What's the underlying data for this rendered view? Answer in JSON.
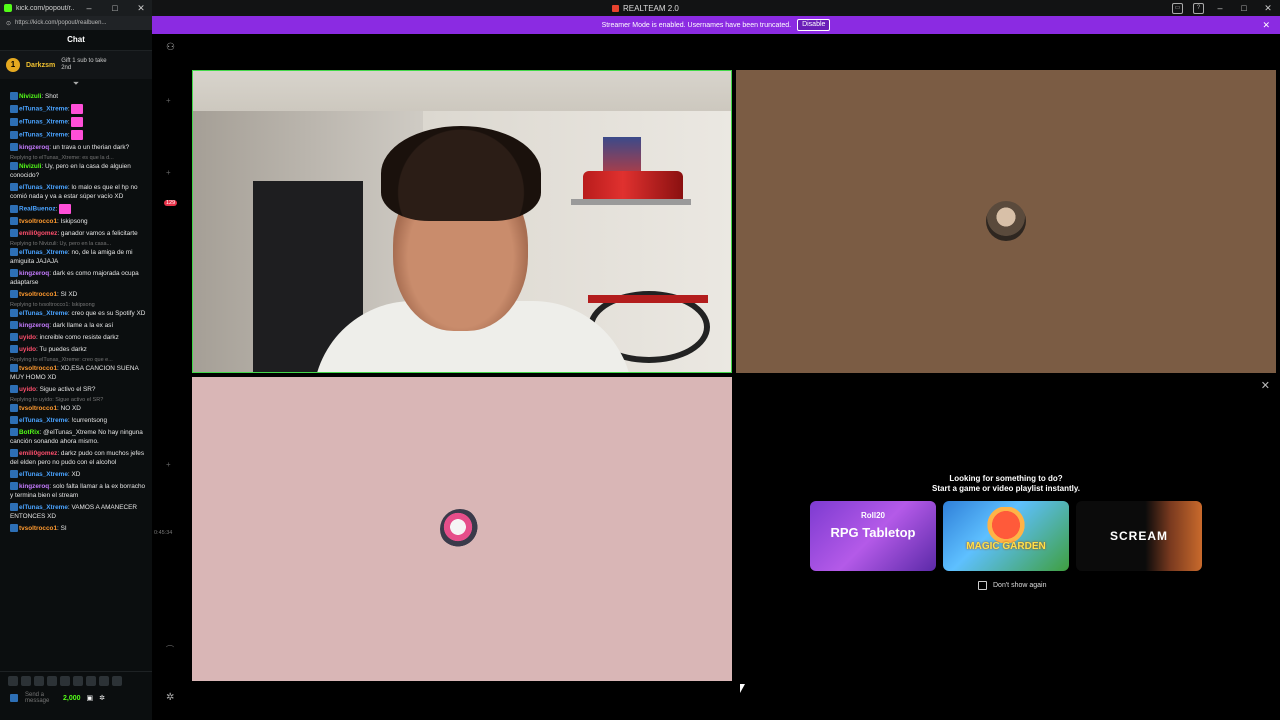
{
  "popout": {
    "title": "kick.com/popout/r...",
    "url": "https://kick.com/popout/realbuen...",
    "controls": [
      "–",
      "□",
      "✕"
    ]
  },
  "chat": {
    "header": "Chat",
    "pinned": {
      "rank": "1",
      "name": "Darkzsm",
      "info": "Gift 1 sub to take 2nd"
    },
    "messages": [
      {
        "user": "Nivizuli",
        "color": "#53fc18",
        "text": "Shot",
        "reply": ""
      },
      {
        "user": "elTunas_Xtreme",
        "color": "#4aa3ff",
        "text": "",
        "reply": ""
      },
      {
        "user": "elTunas_Xtreme",
        "color": "#4aa3ff",
        "text": "",
        "reply": ""
      },
      {
        "user": "elTunas_Xtreme",
        "color": "#4aa3ff",
        "text": "",
        "reply": ""
      },
      {
        "user": "kingzeroq",
        "color": "#c57bff",
        "text": "un trava o un therian dark?",
        "reply": ""
      },
      {
        "user": "Nivizuli",
        "color": "#53fc18",
        "text": "Uy, pero en la casa de alguien conocido?",
        "reply": "Replying to elTunas_Xtreme: es que la d..."
      },
      {
        "user": "elTunas_Xtreme",
        "color": "#4aa3ff",
        "text": "lo malo es que el hp no comió nada y va a estar súper vacío XD",
        "reply": ""
      },
      {
        "user": "RealBuenoz",
        "color": "#4aa3ff",
        "text": "",
        "reply": ""
      },
      {
        "user": "tvsoltrocco1",
        "color": "#ff9a2f",
        "text": "Iskipsong",
        "reply": ""
      },
      {
        "user": "emili0gomez",
        "color": "#ff4f6d",
        "text": "ganador vamos a felicitarte",
        "reply": ""
      },
      {
        "user": "elTunas_Xtreme",
        "color": "#4aa3ff",
        "text": "no, de la amiga de mi amiguita JAJAJA",
        "reply": "Replying to Nivizuli: Uy, pero en la casa..."
      },
      {
        "user": "kingzeroq",
        "color": "#c57bff",
        "text": "dark es como majorada ocupa adaptarse",
        "reply": ""
      },
      {
        "user": "tvsoltrocco1",
        "color": "#ff9a2f",
        "text": "SI XD",
        "reply": ""
      },
      {
        "user": "elTunas_Xtreme",
        "color": "#4aa3ff",
        "text": "creo que es su Spotify XD",
        "reply": "Replying to tvsoltrocco1: Iskipsong"
      },
      {
        "user": "kingzeroq",
        "color": "#c57bff",
        "text": "dark llame a la ex así",
        "reply": ""
      },
      {
        "user": "uyido",
        "color": "#ff4f6d",
        "text": "increible como resiste darkz",
        "reply": ""
      },
      {
        "user": "uyido",
        "color": "#ff4f6d",
        "text": "Tu puedes darkz",
        "reply": ""
      },
      {
        "user": "tvsoltrocco1",
        "color": "#ff9a2f",
        "text": "XD,ESA CANCION SUENA MUY HOMO XD",
        "reply": "Replying to elTunas_Xtreme: creo que e..."
      },
      {
        "user": "uyido",
        "color": "#ff4f6d",
        "text": "Sigue activo el SR?",
        "reply": ""
      },
      {
        "user": "tvsoltrocco1",
        "color": "#ff9a2f",
        "text": "NO XD",
        "reply": "Replying to uyido: Sigue activo el SR?"
      },
      {
        "user": "elTunas_Xtreme",
        "color": "#4aa3ff",
        "text": "!currentsong",
        "reply": ""
      },
      {
        "user": "BotRix",
        "color": "#53fc18",
        "text": "@elTunas_Xtreme No hay ninguna canción sonando ahora mismo.",
        "reply": ""
      },
      {
        "user": "emili0gomez",
        "color": "#ff4f6d",
        "text": "darkz pudo con muchos jefes del elden pero no pudo con el alcohol",
        "reply": ""
      },
      {
        "user": "elTunas_Xtreme",
        "color": "#4aa3ff",
        "text": "XD",
        "reply": ""
      },
      {
        "user": "kingzeroq",
        "color": "#c57bff",
        "text": "solo falta llamar a la ex borracho y termina bien el stream",
        "reply": ""
      },
      {
        "user": "elTunas_Xtreme",
        "color": "#4aa3ff",
        "text": "VAMOS A AMANECER ENTONCES XD",
        "reply": ""
      },
      {
        "user": "tvsoltrocco1",
        "color": "#ff9a2f",
        "text": "SI",
        "reply": ""
      }
    ],
    "footer": {
      "placeholder": "Send a message",
      "points": "2,000"
    }
  },
  "app": {
    "title": "REALTEAM 2.0",
    "controls": [
      "–",
      "□",
      "✕"
    ]
  },
  "banner": {
    "text": "Streamer Mode is enabled. Usernames have been truncated.",
    "button": "Disable"
  },
  "side": {
    "badge": "129",
    "timer": "0:45:34"
  },
  "activity": {
    "title_line1": "Looking for something to do?",
    "title_line2": "Start a game or video playlist instantly.",
    "cards": [
      {
        "name": "RPG Tabletop",
        "brand": "Roll20"
      },
      {
        "name": "MAGIC GARDEN"
      },
      {
        "name": "SCREAM"
      }
    ],
    "dont_show": "Don't show again"
  }
}
